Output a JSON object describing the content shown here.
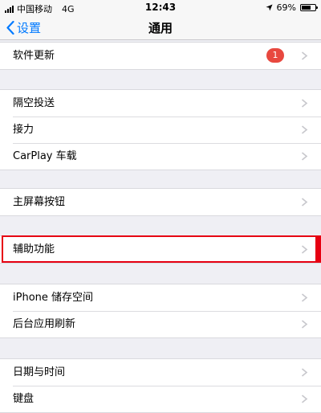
{
  "status_bar": {
    "carrier": "中国移动",
    "network": "4G",
    "time": "12:43",
    "battery_percent": "69%",
    "battery_level": 0.69
  },
  "nav": {
    "back_label": "设置",
    "title": "通用"
  },
  "groups": [
    {
      "items": [
        {
          "label": "软件更新",
          "badge": "1"
        }
      ]
    },
    {
      "items": [
        {
          "label": "隔空投送"
        },
        {
          "label": "接力"
        },
        {
          "label": "CarPlay 车载"
        }
      ]
    },
    {
      "items": [
        {
          "label": "主屏幕按钮"
        }
      ]
    },
    {
      "items": [
        {
          "label": "辅助功能",
          "highlighted": true
        }
      ]
    },
    {
      "items": [
        {
          "label": "iPhone 储存空间"
        },
        {
          "label": "后台应用刷新"
        }
      ]
    },
    {
      "items": [
        {
          "label": "日期与时间"
        },
        {
          "label": "键盘"
        }
      ]
    }
  ],
  "colors": {
    "accent": "#007aff",
    "badge": "#e8483f",
    "highlight": "#e60012",
    "background": "#efeff4"
  }
}
